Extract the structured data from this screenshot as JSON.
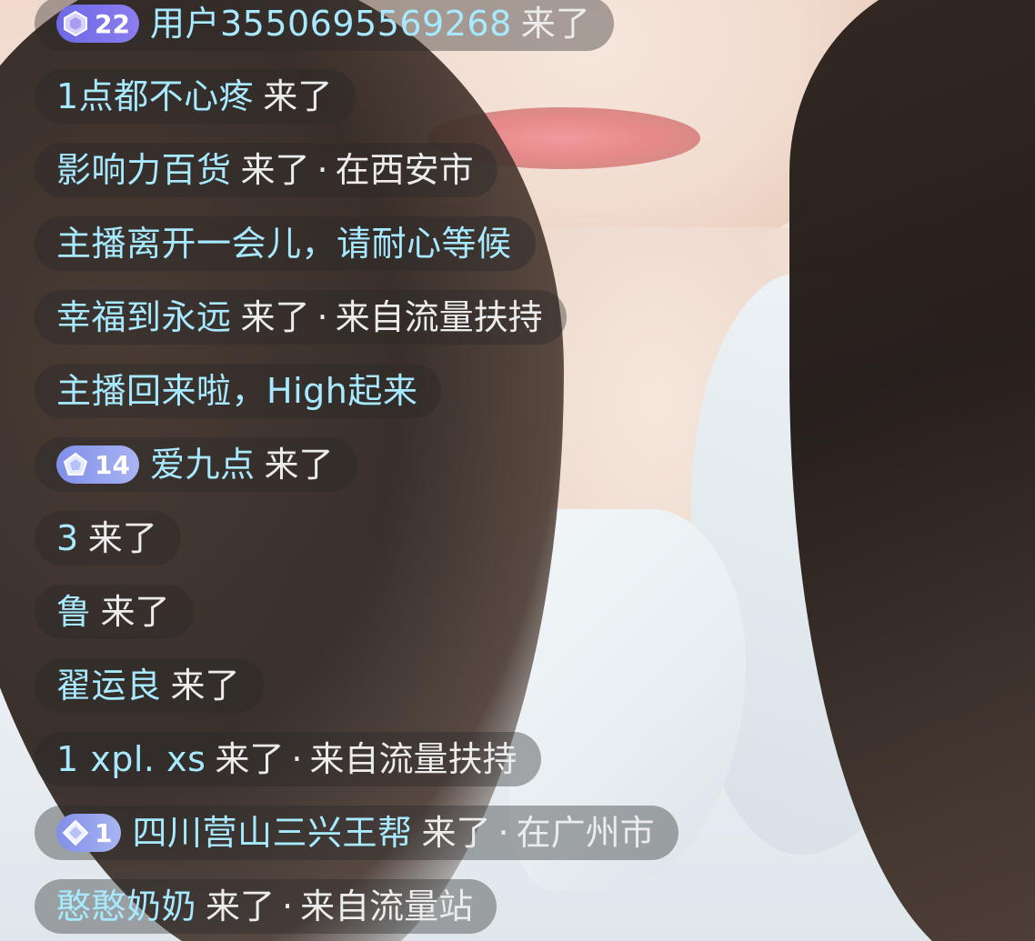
{
  "chat": {
    "messages": [
      {
        "badge": "22",
        "badge_icon": "hexagon-gem-icon",
        "badge_color": "#7a71ea",
        "name": "用户3550695569268",
        "action": "来了",
        "sep": "",
        "detail": ""
      },
      {
        "badge": "",
        "name": "1点都不心疼",
        "action": "来了",
        "sep": "",
        "detail": ""
      },
      {
        "badge": "",
        "name": "影响力百货",
        "action": "来了",
        "sep": "·",
        "detail": "在西安市"
      },
      {
        "badge": "",
        "name": "主播离开一会儿，请耐心等候",
        "action": "",
        "sep": "",
        "detail": ""
      },
      {
        "badge": "",
        "name": "幸福到永远",
        "action": "来了",
        "sep": "·",
        "detail": "来自流量扶持"
      },
      {
        "badge": "",
        "name": "主播回来啦，High起来",
        "action": "",
        "sep": "",
        "detail": ""
      },
      {
        "badge": "14",
        "badge_icon": "pentagon-gem-icon",
        "badge_color": "#8c98ee",
        "name": "爱九点",
        "action": "来了",
        "sep": "",
        "detail": ""
      },
      {
        "badge": "",
        "name": "3",
        "action": "来了",
        "sep": "",
        "detail": ""
      },
      {
        "badge": "",
        "name": "鲁",
        "action": "来了",
        "sep": "",
        "detail": ""
      },
      {
        "badge": "",
        "name": "翟运良",
        "action": "来了",
        "sep": "",
        "detail": ""
      },
      {
        "badge": "",
        "name": "1 xpl. xs",
        "action": "来了",
        "sep": "·",
        "detail": "来自流量扶持"
      },
      {
        "badge": "1",
        "badge_icon": "diamond-gem-icon",
        "badge_color": "#8c98ee",
        "name": "四川营山三兴王帮",
        "action": "来了",
        "sep": "·",
        "detail": "在广州市"
      },
      {
        "badge": "",
        "name": "憨憨奶奶",
        "action": "来了",
        "sep": "·",
        "detail": "来自流量站"
      }
    ]
  },
  "colors": {
    "name_text": "#a7e9ff",
    "action_text": "#ececec",
    "bubble_bg": "rgba(40,40,40,0.38)"
  }
}
